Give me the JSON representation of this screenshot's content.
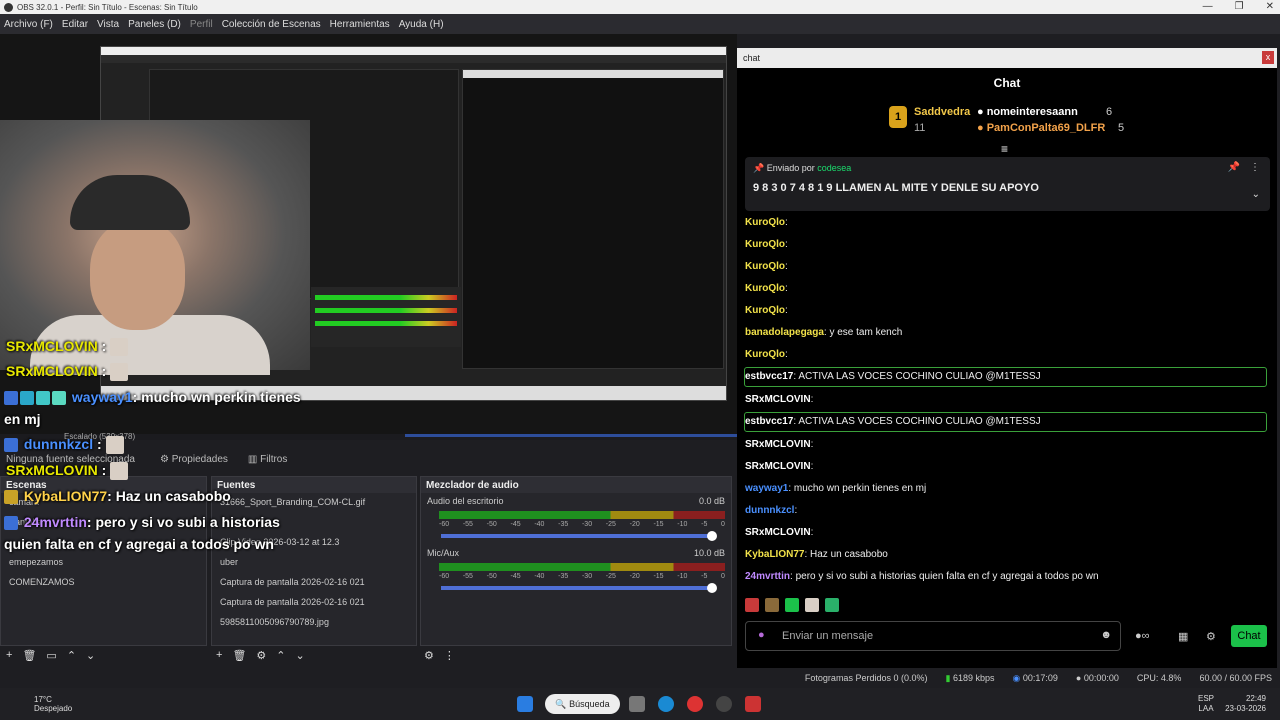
{
  "window": {
    "title": "OBS 32.0.1 - Perfil: Sin Título - Escenas: Sin Título",
    "controls": [
      "—",
      "❐",
      "✕"
    ]
  },
  "menu": [
    "Archivo (F)",
    "Editar",
    "Vista",
    "Paneles (D)",
    "Perfil",
    "Colección de Escenas",
    "Herramientas",
    "Ayuda (H)"
  ],
  "overlay": {
    "lines": [
      {
        "user": "SRxMCLOVIN",
        "text": " :"
      },
      {
        "user": "SRxMCLOVIN",
        "text": " :"
      },
      {
        "user": "wayway1",
        "text": ": mucho wn perkin tienes"
      },
      {
        "user": "",
        "text": "en mj"
      },
      {
        "user": "dunnnkzcl",
        "text": " :"
      },
      {
        "user": "SRxMCLOVIN",
        "text": " :"
      },
      {
        "user": "KybaLION77",
        "text": ": Haz un casabobo"
      },
      {
        "user": "24mvrttin",
        "text": ": pero y si vo subi a historias"
      },
      {
        "user": "",
        "text": "quien falta en cf y agregai a todos po wn"
      }
    ]
  },
  "scale_label": "Escalado (539x378)",
  "no_source": "Ninguna fuente seleccionada",
  "tabs": {
    "properties": "Propiedades",
    "filters": "Filtros"
  },
  "scenes": {
    "header": "Escenas",
    "items": [
      "camara",
      "Pantalla",
      "",
      "emepezamos",
      "COMENZAMOS"
    ]
  },
  "sources": {
    "header": "Fuentes",
    "items": [
      "31666_Sport_Branding_COM-CL.gif",
      "",
      "Clip Video 2026-03-12 at 12.3",
      "uber",
      "Captura de pantalla 2026-02-16 021",
      "Captura de pantalla 2026-02-16 021",
      "5985811005096790789.jpg"
    ]
  },
  "mixer": {
    "header": "Mezclador de audio",
    "channels": [
      {
        "name": "Audio del escritorio",
        "db": "0.0 dB",
        "level": 0.82
      },
      {
        "name": "Mic/Aux",
        "db": "10.0 dB",
        "level": 0.8
      }
    ],
    "scale": [
      "-60",
      "-55",
      "-50",
      "-45",
      "-40",
      "-35",
      "-30",
      "-25",
      "-20",
      "-15",
      "-10",
      "-5",
      "0"
    ]
  },
  "chat": {
    "window_title": "chat",
    "header": "Chat",
    "leaders": [
      {
        "rank": "1",
        "name": "Saddvedra",
        "count": "11"
      },
      {
        "name": "nomeinteresaann",
        "count": "6"
      },
      {
        "name": "PamConPalta69_DLFR",
        "count": "5"
      }
    ],
    "pinned_by_label": "Enviado por",
    "pinned_by_user": "codesea",
    "pinned_message": "9 8 3 0 7 4 8 1 9 LLAMEN AL MITE Y DENLE SU APOYO",
    "messages": [
      {
        "user": "KuroQlo",
        "text": ":",
        "color": "#f2e24a"
      },
      {
        "user": "KuroQlo",
        "text": ":",
        "color": "#f2e24a"
      },
      {
        "user": "KuroQlo",
        "text": ":",
        "color": "#f2e24a"
      },
      {
        "user": "KuroQlo",
        "text": ":",
        "color": "#f2e24a"
      },
      {
        "user": "KuroQlo",
        "text": ":",
        "color": "#f2e24a"
      },
      {
        "user": "banadolapegaga",
        "text": ": y ese tam kench",
        "color": "#f2e24a"
      },
      {
        "user": "KuroQlo",
        "text": ":",
        "color": "#f2e24a"
      },
      {
        "user": "estbvcc17",
        "text": ": ACTIVA LAS VOCES COCHINO CULIAO @M1TESSJ",
        "color": "#ffffff"
      },
      {
        "user": "SRxMCLOVIN",
        "text": ":",
        "color": "#ffffff"
      },
      {
        "user": "estbvcc17",
        "text": ": ACTIVA LAS VOCES COCHINO CULIAO @M1TESSJ",
        "color": "#ffffff"
      },
      {
        "user": "SRxMCLOVIN",
        "text": ":",
        "color": "#ffffff"
      },
      {
        "user": "SRxMCLOVIN",
        "text": ":",
        "color": "#ffffff"
      },
      {
        "user": "wayway1",
        "text": ": mucho wn perkin tienes en mj",
        "color": "#4a90ff"
      },
      {
        "user": "dunnnkzcl",
        "text": ":",
        "color": "#4a90ff"
      },
      {
        "user": "SRxMCLOVIN",
        "text": ":",
        "color": "#ffffff"
      },
      {
        "user": "KybaLION77",
        "text": ": Haz un casabobo",
        "color": "#f2e24a"
      },
      {
        "user": "24mvrttin",
        "text": ": pero y si vo subi a historias quien falta en cf y agregai a todos po wn",
        "color": "#c08aff"
      }
    ],
    "input_placeholder": "Enviar un mensaje",
    "send_label": "Chat"
  },
  "status": {
    "dropped": "Fotogramas Perdidos 0 (0.0%)",
    "bitrate": "6189 kbps",
    "stream_time": "00:17:09",
    "rec_time": "00:00:00",
    "cpu": "CPU: 4.8%",
    "fps": "60.00 / 60.00 FPS"
  },
  "taskbar": {
    "temp": "17°C",
    "weather": "Despejado",
    "search": "Búsqueda",
    "lang1": "ESP",
    "lang2": "LAA",
    "time": "22:49",
    "date": "23-03-2026"
  },
  "colors": {
    "accent_green": "#1bc14a",
    "obs_bg": "#1e1e22",
    "highlight_border": "#3aa13a"
  }
}
